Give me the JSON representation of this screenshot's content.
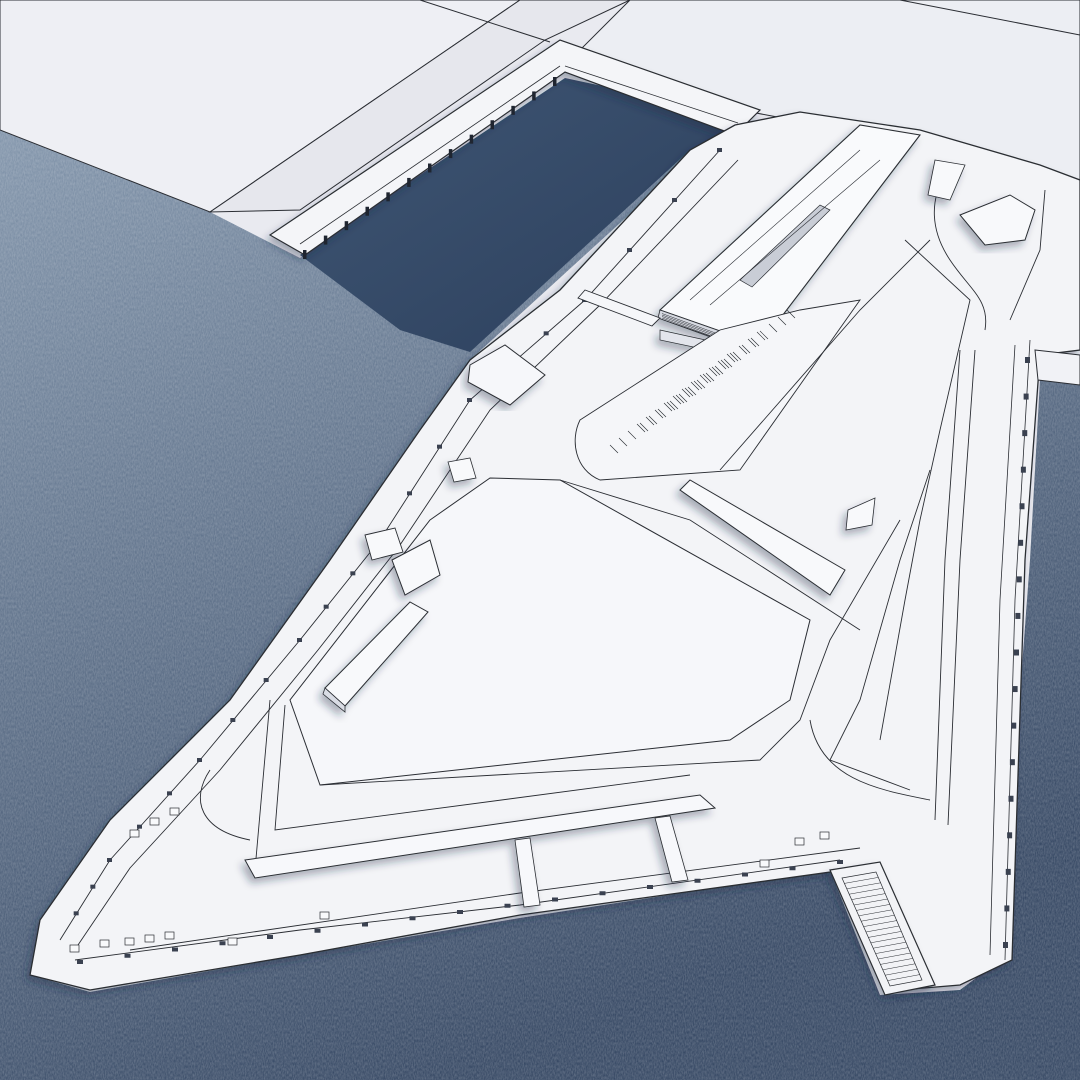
{
  "scene": {
    "subject": "",
    "colors": {
      "water_light": "#7f93aa",
      "water_dark": "#2c3f5c",
      "land": "#e8e9ef",
      "ground": "#eeeff4",
      "line": "#2a2d33",
      "structure": "#f6f7fa"
    }
  }
}
